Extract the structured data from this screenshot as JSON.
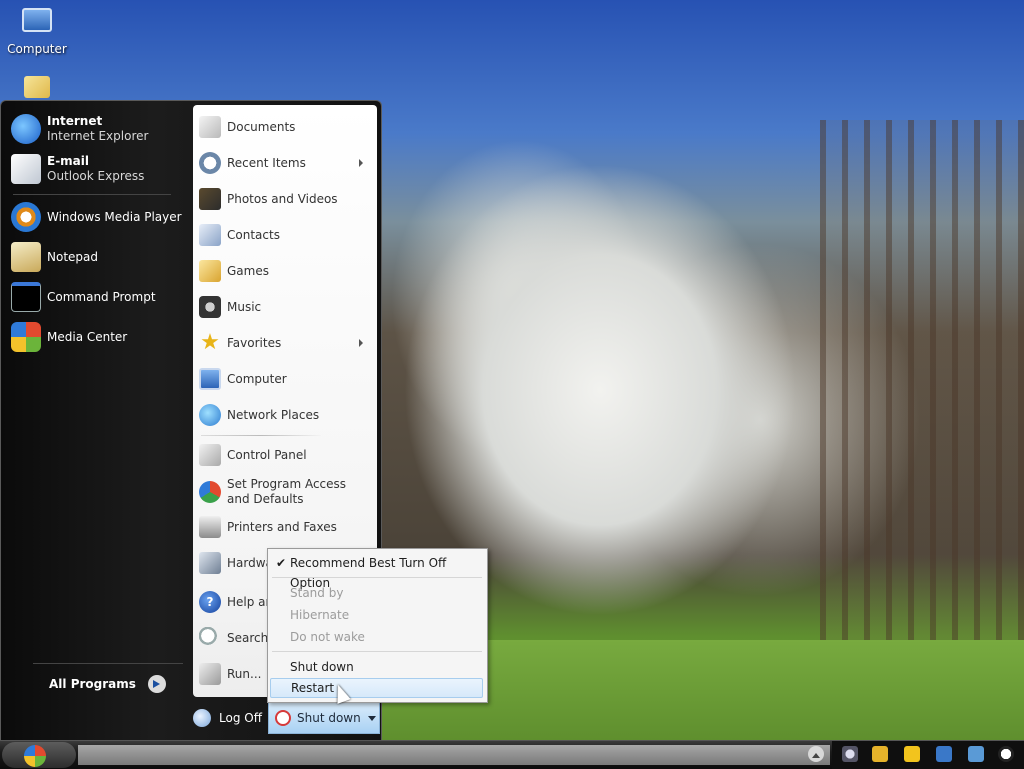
{
  "desktop": {
    "icons": [
      {
        "label": "Computer",
        "icon": "computer-icon"
      },
      {
        "label": "",
        "icon": "mail-icon"
      }
    ]
  },
  "start_menu": {
    "pinned": [
      {
        "title": "Internet",
        "subtitle": "Internet Explorer",
        "icon": "internet-explorer-icon"
      },
      {
        "title": "E-mail",
        "subtitle": "Outlook Express",
        "icon": "outlook-express-icon"
      }
    ],
    "recent": [
      {
        "label": "Windows Media Player",
        "icon": "media-player-icon"
      },
      {
        "label": "Notepad",
        "icon": "notepad-icon"
      },
      {
        "label": "Command Prompt",
        "icon": "command-prompt-icon"
      },
      {
        "label": "Media Center",
        "icon": "media-center-icon"
      }
    ],
    "all_programs": "All Programs",
    "places": [
      {
        "label": "Documents",
        "icon": "documents-icon",
        "submenu": false
      },
      {
        "label": "Recent Items",
        "icon": "recent-items-icon",
        "submenu": true
      },
      {
        "label": "Photos and Videos",
        "icon": "photos-icon",
        "submenu": false
      },
      {
        "label": "Contacts",
        "icon": "contacts-icon",
        "submenu": false
      },
      {
        "label": "Games",
        "icon": "games-icon",
        "submenu": false
      },
      {
        "label": "Music",
        "icon": "music-icon",
        "submenu": false
      },
      {
        "label": "Favorites",
        "icon": "favorites-star-icon",
        "submenu": true
      },
      {
        "label": "Computer",
        "icon": "computer-icon",
        "submenu": false
      },
      {
        "label": "Network Places",
        "icon": "network-icon",
        "submenu": false
      }
    ],
    "system": [
      {
        "label": "Control Panel",
        "icon": "control-panel-icon"
      },
      {
        "label": "Set Program Access and Defaults",
        "icon": "program-access-icon"
      },
      {
        "label": "Printers and Faxes",
        "icon": "printer-icon"
      },
      {
        "label": "Hardwa",
        "icon": "hardware-icon"
      },
      {
        "label": "Help an",
        "icon": "help-icon"
      },
      {
        "label": "Search",
        "icon": "search-icon"
      },
      {
        "label": "Run...",
        "icon": "run-icon"
      }
    ],
    "log_off": "Log Off",
    "shut_down": "Shut down"
  },
  "context_menu": {
    "items": [
      {
        "label": "Recommend Best Turn Off Option",
        "checked": true,
        "disabled": false
      },
      {
        "label": "Stand by",
        "checked": false,
        "disabled": true
      },
      {
        "label": "Hibernate",
        "checked": false,
        "disabled": true
      },
      {
        "label": "Do not wake",
        "checked": false,
        "disabled": true
      },
      {
        "label": "Shut down",
        "checked": false,
        "disabled": false
      },
      {
        "label": "Restart",
        "checked": false,
        "disabled": false,
        "hover": true
      }
    ],
    "check_glyph": "✔"
  },
  "colors": {
    "accent": "#a9d1f3",
    "menu_hover": "#d6e9fa",
    "shutdown_ring": "#d63a3a"
  }
}
